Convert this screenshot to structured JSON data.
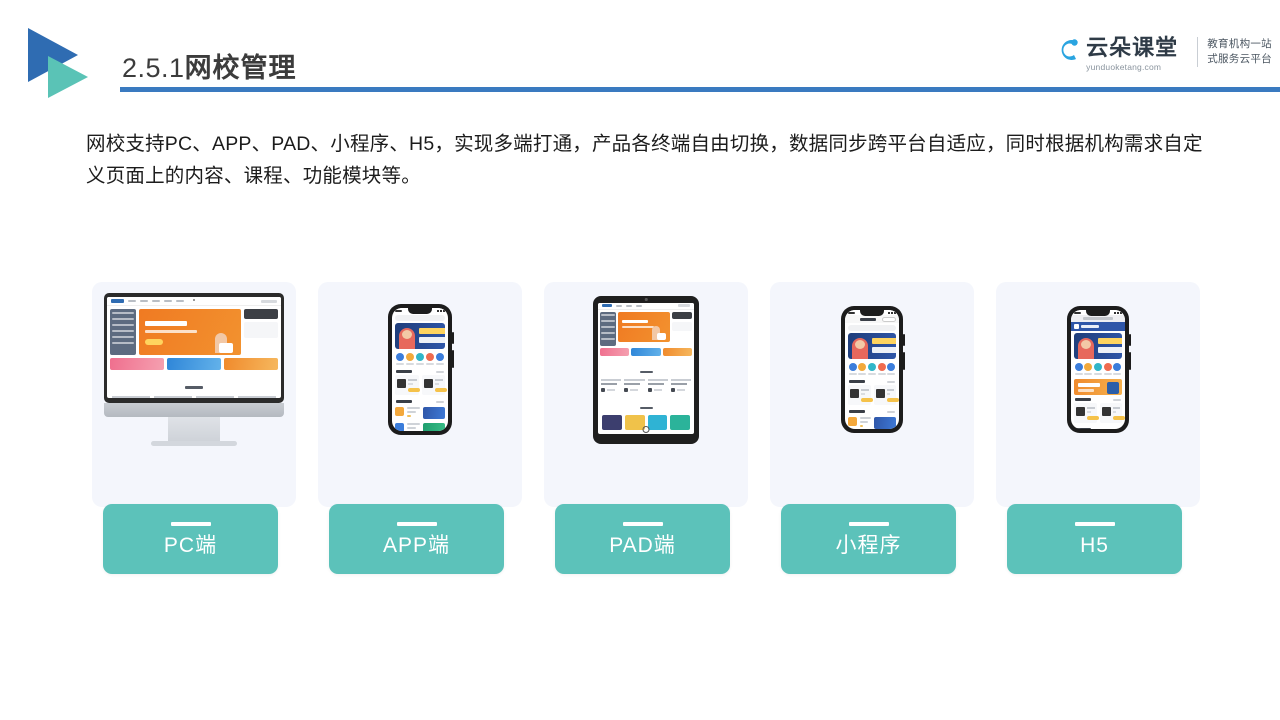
{
  "header": {
    "title_number": "2.5.1",
    "title_text": "网校管理",
    "accent_blue": "#3a7ac0",
    "logo_triangle_blue": "#2f6cb2",
    "logo_triangle_teal": "#5ac3b6",
    "brand": {
      "name_cn": "云朵课堂",
      "name_en": "yunduoketang.com",
      "tagline_line1": "教育机构一站",
      "tagline_line2": "式服务云平台"
    }
  },
  "body": {
    "paragraph": "网校支持PC、APP、PAD、小程序、H5，实现多端打通，产品各终端自由切换，数据同步跨平台自适应，同时根据机构需求自定义页面上的内容、课程、功能模块等。"
  },
  "cards": {
    "label_color": "#5cc2ba",
    "panel_color": "#f4f6fc",
    "items": [
      {
        "label": "PC端",
        "device": "monitor"
      },
      {
        "label": "APP端",
        "device": "phone"
      },
      {
        "label": "PAD端",
        "device": "tablet"
      },
      {
        "label": "小程序",
        "device": "phone-mini"
      },
      {
        "label": "H5",
        "device": "phone-h5"
      }
    ]
  }
}
